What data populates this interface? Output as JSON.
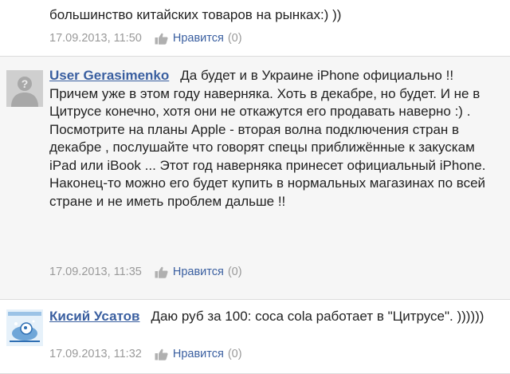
{
  "top_comment": {
    "text_tail": "большинство китайских товаров на рынках:) ))",
    "date": "17.09.2013, 11:50",
    "like_label": "Нравится",
    "like_count": "(0)"
  },
  "comments": [
    {
      "author": "User Gerasimenko",
      "paragraph_1": "Да будет и в Украине iPhone официально !! Причем уже в этом году наверняка. Хоть в декабре, но будет. И не в Цитрусе конечно, хотя они не откажутся его продавать наверно :) .",
      "paragraph_2": "Посмотрите на планы Apple - вторая волна подключения стран в декабре , послушайте что говорят спецы приближённые к закускам iPad или iBook ... Этот год наверняка принесет официальный iPhone. Наконец-то можно его будет купить в нормальных магазинах по всей стране и не иметь проблем дальше !!",
      "date": "17.09.2013, 11:35",
      "like_label": "Нравится",
      "like_count": "(0)",
      "avatar_icon": "default-user-silhouette-icon"
    },
    {
      "author": "Кисий Усатов",
      "paragraph_1": "Даю руб за 100: coca cola работает в \"Цитрусе\". ))))))",
      "date": "17.09.2013, 11:32",
      "like_label": "Нравится",
      "like_count": "(0)",
      "avatar_icon": "blue-image-avatar-icon"
    }
  ],
  "colors": {
    "link": "#3a5fa0",
    "meta": "#9a9a9a",
    "highlight_bg": "#f6f6f6"
  }
}
